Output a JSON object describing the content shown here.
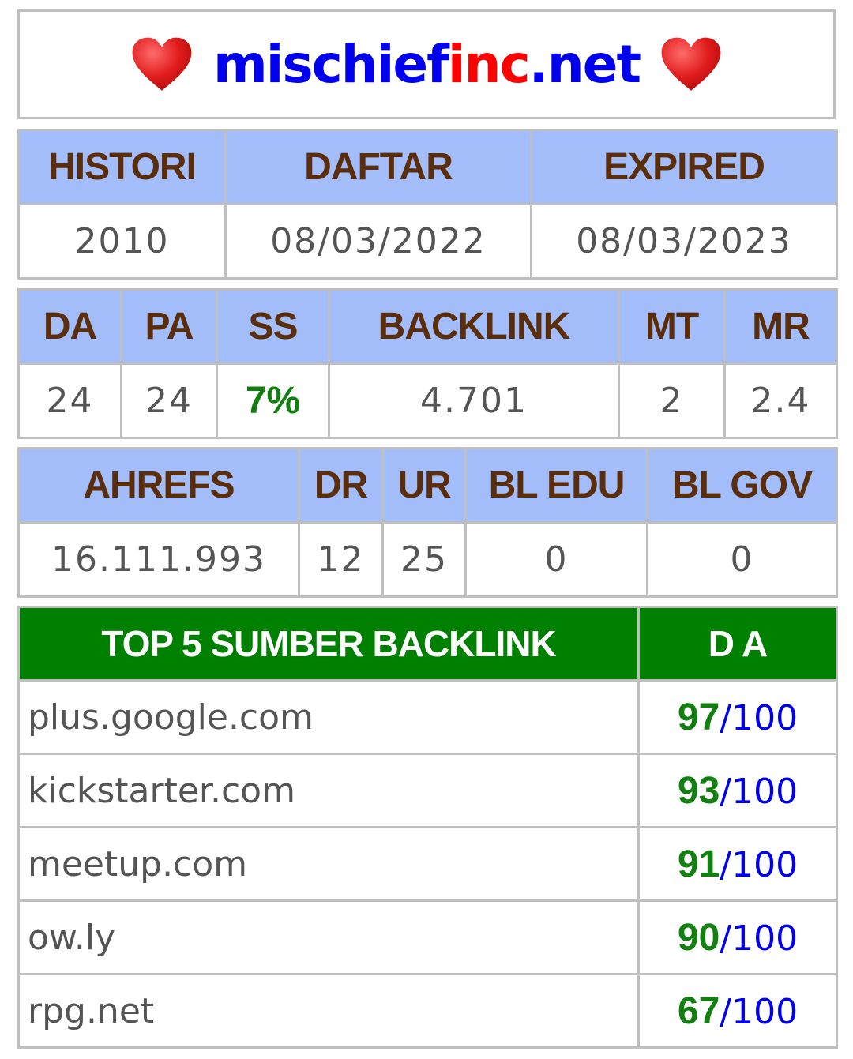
{
  "title": {
    "part1": "mischief",
    "part2": "inc",
    "part3": ".net",
    "heart_icon": "red-heart-icon",
    "colors": {
      "blue": "#0000ee",
      "red": "#ff0000"
    }
  },
  "history_table": {
    "headers": [
      "HISTORI",
      "DAFTAR",
      "EXPIRED"
    ],
    "values": [
      "2010",
      "08/03/2022",
      "08/03/2023"
    ]
  },
  "metrics_table": {
    "headers": [
      "DA",
      "PA",
      "SS",
      "BACKLINK",
      "MT",
      "MR"
    ],
    "values": [
      "24",
      "24",
      "7%",
      "4.701",
      "2",
      "2.4"
    ]
  },
  "ahrefs_table": {
    "headers": [
      "AHREFS",
      "DR",
      "UR",
      "BL EDU",
      "BL GOV"
    ],
    "values": [
      "16.111.993",
      "12",
      "25",
      "0",
      "0"
    ]
  },
  "backlinks_table": {
    "headers": [
      "TOP 5 SUMBER BACKLINK",
      "D A"
    ],
    "rows": [
      {
        "domain": "plus.google.com",
        "da": "97",
        "sep": "/",
        "max": "100"
      },
      {
        "domain": "kickstarter.com",
        "da": "93",
        "sep": "/",
        "max": "100"
      },
      {
        "domain": "meetup.com",
        "da": "91",
        "sep": "/",
        "max": "100"
      },
      {
        "domain": "ow.ly",
        "da": "90",
        "sep": "/",
        "max": "100"
      },
      {
        "domain": "rpg.net",
        "da": "67",
        "sep": "/",
        "max": "100"
      }
    ]
  },
  "colors": {
    "header_bg": "#a3bdfb",
    "header_text": "#5a2d0c",
    "green": "#008000",
    "border": "#bfbfbf"
  }
}
